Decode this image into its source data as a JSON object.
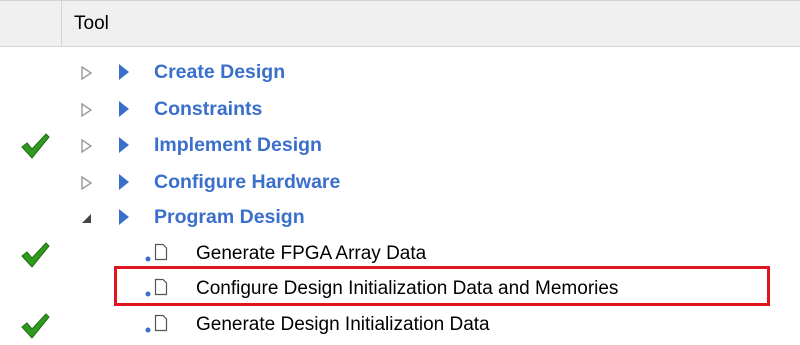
{
  "header": {
    "title": "Tool"
  },
  "tree": {
    "groups": [
      {
        "label": "Create Design",
        "checked": false,
        "expanded": false
      },
      {
        "label": "Constraints",
        "checked": false,
        "expanded": false
      },
      {
        "label": "Implement Design",
        "checked": true,
        "expanded": false
      },
      {
        "label": "Configure Hardware",
        "checked": false,
        "expanded": false
      },
      {
        "label": "Program Design",
        "checked": false,
        "expanded": true
      }
    ],
    "tasks": [
      {
        "label": "Generate FPGA Array Data",
        "checked": true,
        "highlighted": false
      },
      {
        "label": "Configure Design Initialization Data and Memories",
        "checked": false,
        "highlighted": true
      },
      {
        "label": "Generate Design Initialization Data",
        "checked": true,
        "highlighted": false
      }
    ]
  },
  "icons": {
    "check": "check-icon",
    "collapsed": "expander-collapsed-icon",
    "expanded": "expander-expanded-icon",
    "run": "run-icon",
    "bullet": "bullet-icon",
    "document": "document-icon"
  },
  "colors": {
    "group_text": "#3a6fcc",
    "run_icon": "#3a6fcc",
    "check": "#2e9a1e",
    "highlight": "#e0141e",
    "header_bg": "#f0f0f0"
  }
}
